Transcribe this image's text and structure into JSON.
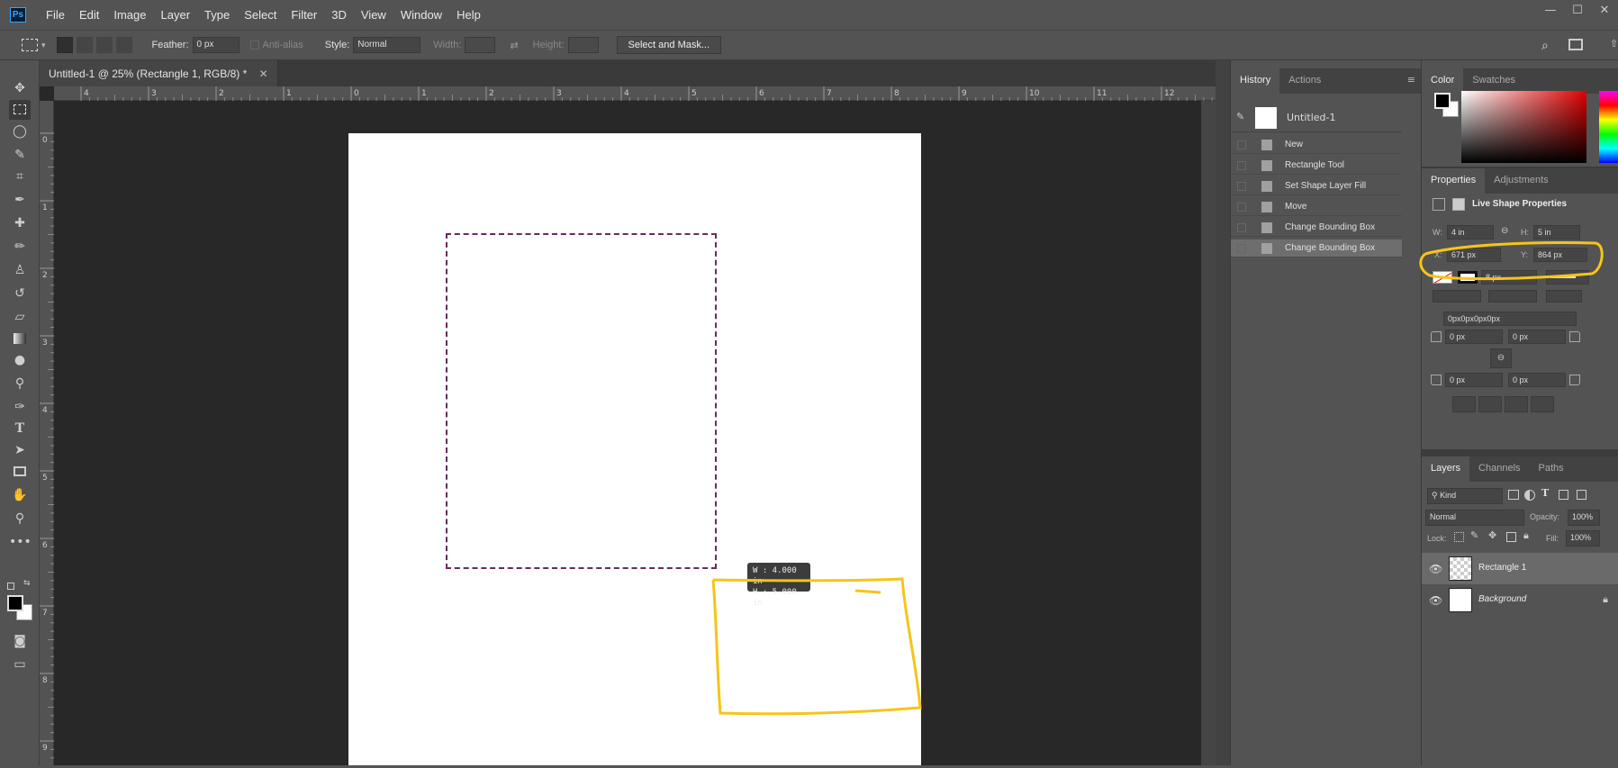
{
  "app": {
    "logo": "Ps"
  },
  "menu": [
    "File",
    "Edit",
    "Image",
    "Layer",
    "Type",
    "Select",
    "Filter",
    "3D",
    "View",
    "Window",
    "Help"
  ],
  "window_controls": {
    "minimize": "—",
    "maximize": "☐",
    "close": "✕"
  },
  "options_bar": {
    "feather_label": "Feather:",
    "feather_value": "0 px",
    "antialias_label": "Anti-alias",
    "style_label": "Style:",
    "style_value": "Normal",
    "width_label": "Width:",
    "height_label": "Height:",
    "select_mask_label": "Select and Mask..."
  },
  "document": {
    "tab_title": "Untitled-1 @ 25% (Rectangle 1, RGB/8) *",
    "close_glyph": "✕",
    "ruler_h": [
      "4",
      "3",
      "2",
      "1",
      "0",
      "1",
      "2",
      "3",
      "4",
      "5",
      "6",
      "7",
      "8",
      "9",
      "10",
      "11",
      "12"
    ],
    "ruler_v": [
      "0",
      "1",
      "2",
      "3",
      "4",
      "5",
      "6",
      "7",
      "8",
      "9"
    ],
    "size_tooltip": {
      "w": "W :   4.000 in",
      "h": "H :   5.000 in"
    }
  },
  "history": {
    "tabs": [
      "History",
      "Actions"
    ],
    "snapshot": "Untitled-1",
    "steps": [
      "New",
      "Rectangle Tool",
      "Set Shape Layer Fill",
      "Move",
      "Change Bounding Box",
      "Change Bounding Box"
    ],
    "selected_index": 5
  },
  "color": {
    "tabs": [
      "Color",
      "Swatches"
    ],
    "foreground": "#000000",
    "background": "#ffffff"
  },
  "properties": {
    "tabs": [
      "Properties",
      "Adjustments"
    ],
    "title": "Live Shape Properties",
    "w_label": "W:",
    "w_value": "4 in",
    "h_label": "H:",
    "h_value": "5 in",
    "x_label": "X:",
    "x_value": "671 px",
    "y_label": "Y:",
    "y_value": "864 px",
    "stroke_width": "8 px",
    "corner_combo": "0px0px0px0px",
    "corner_tl": "0 px",
    "corner_tr": "0 px",
    "corner_bl": "0 px",
    "corner_br": "0 px"
  },
  "layers": {
    "tabs": [
      "Layers",
      "Channels",
      "Paths"
    ],
    "filter_kind": "Kind",
    "blend_mode": "Normal",
    "opacity_label": "Opacity:",
    "opacity_value": "100%",
    "lock_label": "Lock:",
    "fill_label": "Fill:",
    "fill_value": "100%",
    "items": [
      {
        "name": "Rectangle 1",
        "selected": true
      },
      {
        "name": "Background",
        "selected": false
      }
    ]
  },
  "annotation_color": "#f5c518"
}
